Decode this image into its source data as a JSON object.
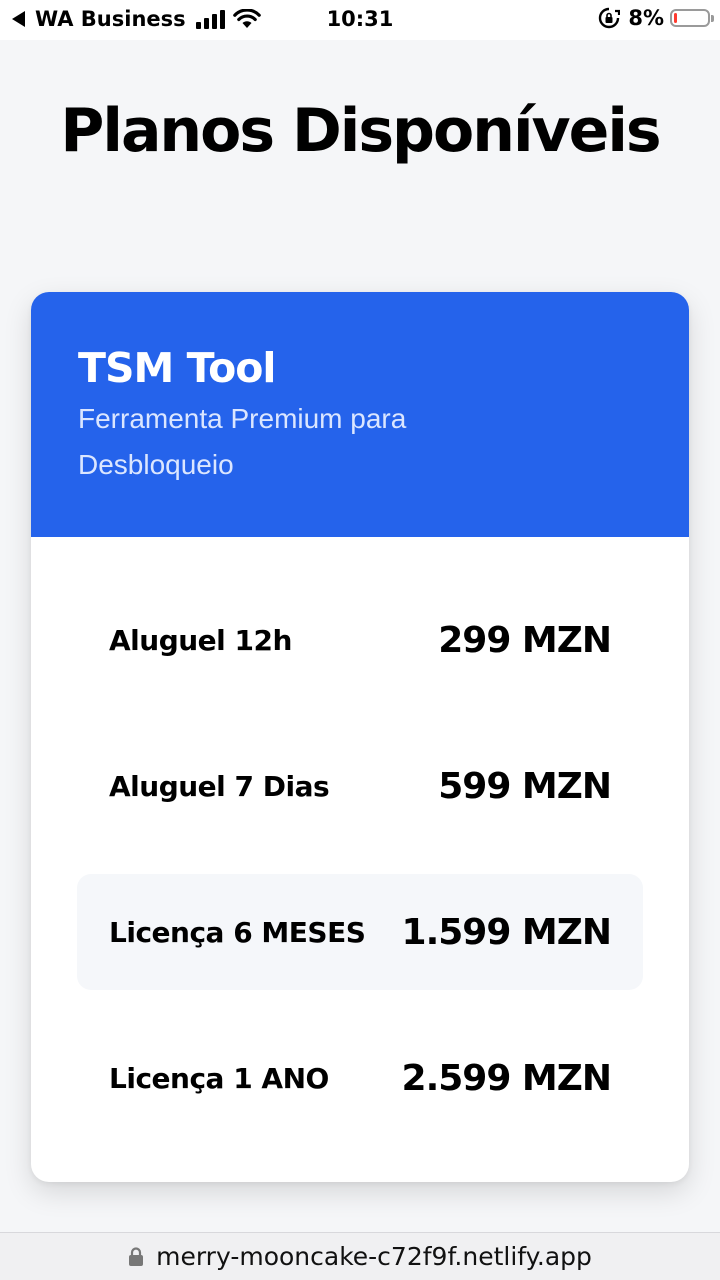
{
  "status_bar": {
    "back_app": "WA Business",
    "time": "10:31",
    "battery_percent": "8%",
    "battery_level": 0.08,
    "icons": [
      "back-arrow-icon",
      "signal-icon",
      "wifi-icon",
      "orientation-lock-icon",
      "battery-icon"
    ]
  },
  "page": {
    "title": "Planos Disponíveis"
  },
  "card": {
    "title": "TSM Tool",
    "subtitle": "Ferramenta Premium para Desbloqueio",
    "accent_color": "#2563eb"
  },
  "plans": [
    {
      "name": "Aluguel 12h",
      "price": "299 MZN"
    },
    {
      "name": "Aluguel 7 Dias",
      "price": "599 MZN"
    },
    {
      "name": "Licença 6 MESES",
      "price": "1.599 MZN"
    },
    {
      "name": "Licença 1 ANO",
      "price": "2.599 MZN"
    }
  ],
  "url_bar": {
    "url": "merry-mooncake-c72f9f.netlify.app",
    "icon": "lock-icon"
  }
}
